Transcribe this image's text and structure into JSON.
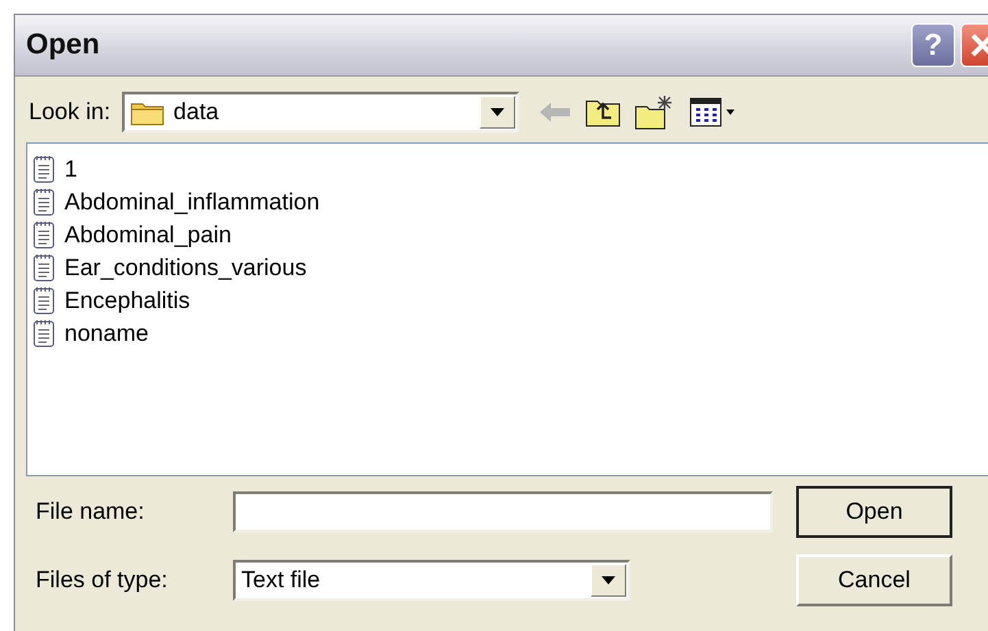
{
  "window": {
    "title": "Open",
    "help_button": "?"
  },
  "look_in": {
    "label": "Look in:",
    "value": "data"
  },
  "files": [
    {
      "name": "1"
    },
    {
      "name": "Abdominal_inflammation"
    },
    {
      "name": "Abdominal_pain"
    },
    {
      "name": "Ear_conditions_various"
    },
    {
      "name": "Encephalitis"
    },
    {
      "name": "noname"
    }
  ],
  "file_name": {
    "label": "File name:"
  },
  "file_type": {
    "label": "Files of type:",
    "value": "Text file"
  },
  "buttons": [
    {
      "label": "Open",
      "default": true
    },
    {
      "label": "Cancel",
      "default": false
    }
  ]
}
